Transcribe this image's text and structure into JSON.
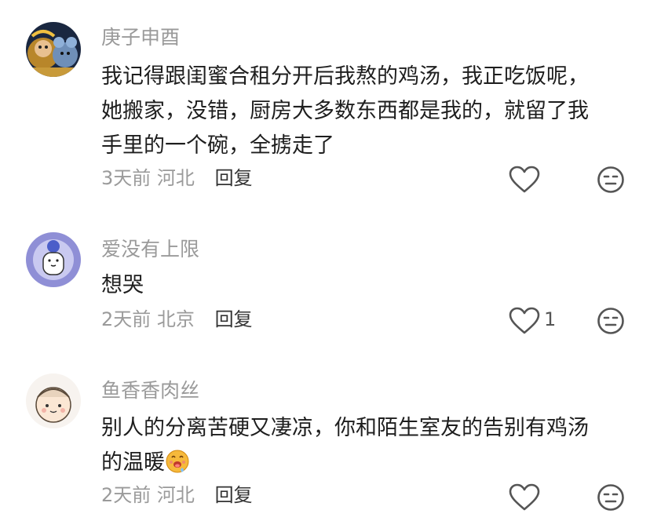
{
  "comments": [
    {
      "username": "庚子申酉",
      "lines": [
        "我记得跟闺蜜合租分开后我熬的鸡汤，我正吃饭呢，",
        "她搬家，没错，厨房大多数东西都是我的，就留了我",
        "手里的一个碗，全掳走了"
      ],
      "time": "3天前",
      "location": "河北",
      "reply_label": "回复",
      "like_count": ""
    },
    {
      "username": "爱没有上限",
      "lines": [
        "想哭"
      ],
      "time": "2天前",
      "location": "北京",
      "reply_label": "回复",
      "like_count": "1"
    },
    {
      "username": "鱼香香肉丝",
      "lines": [
        "别人的分离苦硬又凄凉，你和陌生室友的告别有鸡汤",
        "的温暖"
      ],
      "time": "2天前",
      "location": "河北",
      "reply_label": "回复",
      "like_count": ""
    }
  ],
  "icons": {
    "like": "heart-outline-icon",
    "dislike": "neutral-face-icon",
    "emoji": "drooling-face-emoji"
  },
  "colors": {
    "username": "#9a9a9a",
    "body": "#1e1e1e",
    "meta": "#9a9a9a",
    "reply": "#333333",
    "icon": "#555555"
  }
}
